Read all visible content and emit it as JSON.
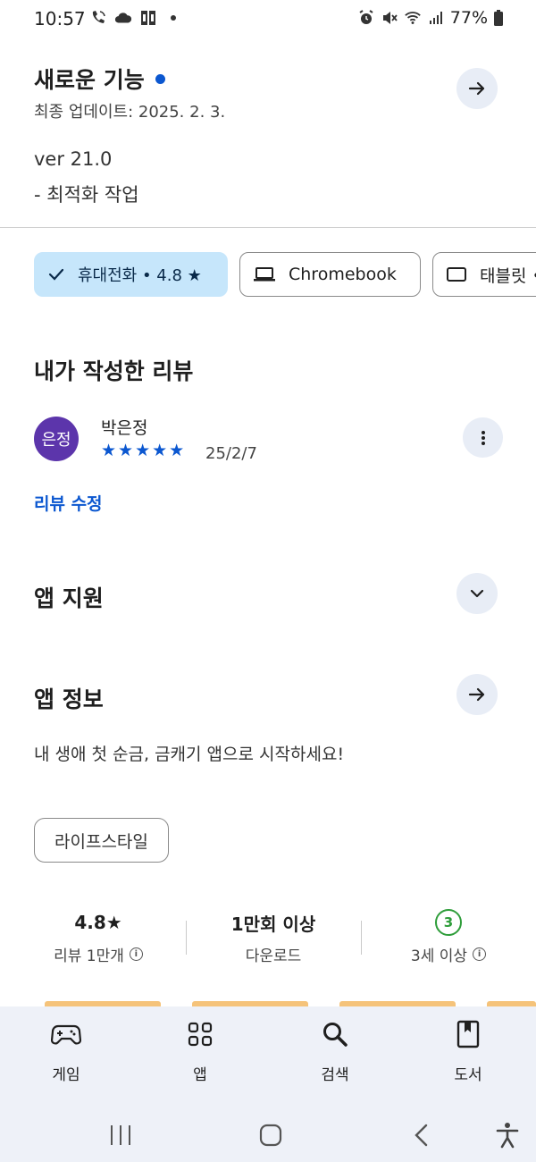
{
  "status_bar": {
    "time": "10:57",
    "battery": "77%",
    "icons": [
      "wifi-call-icon",
      "cloud-icon",
      "app-icon",
      "dot-icon",
      "alarm-icon",
      "mute-icon",
      "wifi-icon",
      "signal-icon",
      "battery-icon"
    ]
  },
  "whats_new": {
    "title": "새로운 기능",
    "last_updated": "최종 업데이트: 2025. 2. 3.",
    "version": "ver 21.0",
    "note": "- 최적화 작업"
  },
  "device_chips": [
    {
      "label": "휴대전화 • 4.8 ★",
      "selected": true,
      "icon": "check-icon"
    },
    {
      "label": "Chromebook",
      "selected": false,
      "icon": "laptop-icon"
    },
    {
      "label": "태블릿 •",
      "selected": false,
      "icon": "tablet-icon"
    }
  ],
  "my_review": {
    "section_title": "내가 작성한 리뷰",
    "avatar_text": "은정",
    "reviewer_name": "박은정",
    "stars": "★★★★★",
    "rating": 5,
    "date": "25/2/7",
    "edit_label": "리뷰 수정"
  },
  "app_support": {
    "title": "앱 지원"
  },
  "app_info": {
    "title": "앱 정보",
    "description": "내 생애 첫 순금, 금캐기 앱으로 시작하세요!",
    "category": "라이프스타일"
  },
  "stats": {
    "rating_value": "4.8★",
    "rating_label": "리뷰 1만개",
    "downloads_value": "1만회 이상",
    "downloads_label": "다운로드",
    "age_value": "3",
    "age_label": "3세 이상"
  },
  "bottom_nav": [
    {
      "label": "게임",
      "icon": "gamepad-icon"
    },
    {
      "label": "앱",
      "icon": "apps-grid-icon"
    },
    {
      "label": "검색",
      "icon": "search-icon"
    },
    {
      "label": "도서",
      "icon": "book-icon"
    }
  ],
  "colors": {
    "accent": "#0b57d0",
    "chip_selected": "#c6e6fb",
    "avatar": "#5c35ab",
    "age_badge": "#2e9d3a",
    "nav_background": "#eef1f8"
  }
}
